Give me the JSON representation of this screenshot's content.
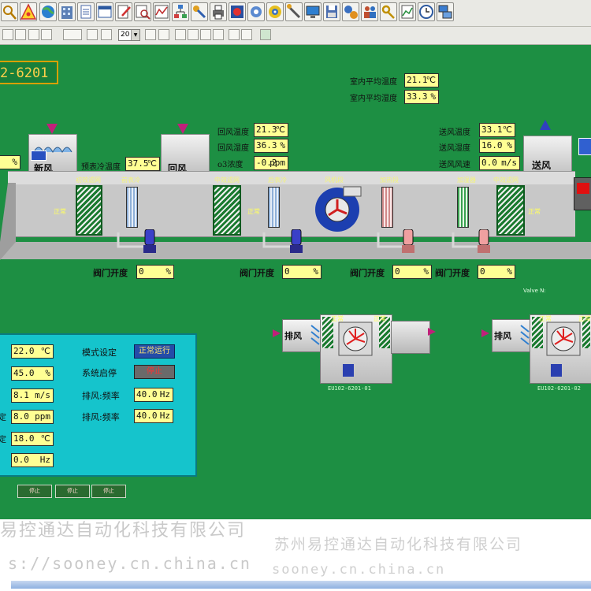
{
  "system_id": "2-6201",
  "room_avg": {
    "temp_label": "室内平均温度",
    "temp_value": "21.1",
    "temp_unit": "℃",
    "hum_label": "室内平均湿度",
    "hum_value": "33.3",
    "hum_unit": "%"
  },
  "left_partial_value": {
    "value": "",
    "unit": "%"
  },
  "precool_temp": {
    "label": "预表冷温度",
    "value": "37.5",
    "unit": "℃"
  },
  "fresh_air": {
    "label": "新风"
  },
  "return_air": {
    "label": "回风",
    "temp_label": "回风温度",
    "temp_value": "21.3",
    "temp_unit": "℃",
    "hum_label": "回风湿度",
    "hum_value": "36.3",
    "hum_unit": "%",
    "o3_label": "o3浓度",
    "o3_value": "-0.2",
    "o3_unit": "ppm"
  },
  "supply_air": {
    "label": "送风",
    "temp_label": "送风温度",
    "temp_value": "33.1",
    "temp_unit": "℃",
    "hum_label": "送风湿度",
    "hum_value": "16.0",
    "hum_unit": "%",
    "speed_label": "送风风速",
    "speed_value": "0.0",
    "speed_unit": "m/s"
  },
  "segments": [
    "初效滤网",
    "前表冷",
    "中效滤网",
    "后表冷",
    "风机段",
    "加热段",
    "加湿器",
    "中效滤网"
  ],
  "status_normal": "正常",
  "valves": [
    {
      "label": "阀门开度",
      "value": "0",
      "unit": "%"
    },
    {
      "label": "阀门开度",
      "value": "0",
      "unit": "%"
    },
    {
      "label": "阀门开度",
      "value": "0",
      "unit": "%"
    },
    {
      "label": "阀门开度",
      "value": "0",
      "unit": "%"
    }
  ],
  "valve_note": "Valve N:",
  "exhaust_units": [
    {
      "label": "排风",
      "id": "EU102-6201-01",
      "status_top": "正常",
      "status_bottom": "正常"
    },
    {
      "label": "排风",
      "id": "EU102-6201-02",
      "status_top": "正常",
      "status_bottom": "正常"
    }
  ],
  "control_panel": {
    "readings": [
      {
        "value": "22.0",
        "unit": "℃"
      },
      {
        "value": "45.0",
        "unit": "%"
      },
      {
        "value": "8.1",
        "unit": "m/s"
      },
      {
        "value": "8.0",
        "unit": "ppm"
      },
      {
        "value": "18.0",
        "unit": "℃"
      },
      {
        "value": "0.0",
        "unit": "Hz"
      }
    ],
    "mode_label": "模式设定",
    "mode_value": "正常运行",
    "system_label": "系统启停",
    "system_value": "停止",
    "exhaust_freq_1_label": "排风:频率",
    "exhaust_freq_1_value": "40.0",
    "exhaust_freq_1_unit": "Hz",
    "exhaust_freq_2_label": "排风:频率",
    "exhaust_freq_2_value": "40.0",
    "exhaust_freq_2_unit": "Hz",
    "bottom_buttons": [
      "停止",
      "停止",
      "停止"
    ]
  },
  "toolbar2": {
    "zoom_value": "20"
  },
  "watermarks": {
    "left_cn": "易控通达自动化科技有限公司",
    "left_url": "s://sooney.cn.china.cn",
    "right_cn": "苏州易控通达自动化科技有限公司",
    "right_url": "sooney.cn.china.cn"
  },
  "colors": {
    "panel_green": "#1d8f43",
    "value_box": "#ffff94",
    "control_panel": "#15c4cc",
    "duct": "#dcdcdc"
  }
}
